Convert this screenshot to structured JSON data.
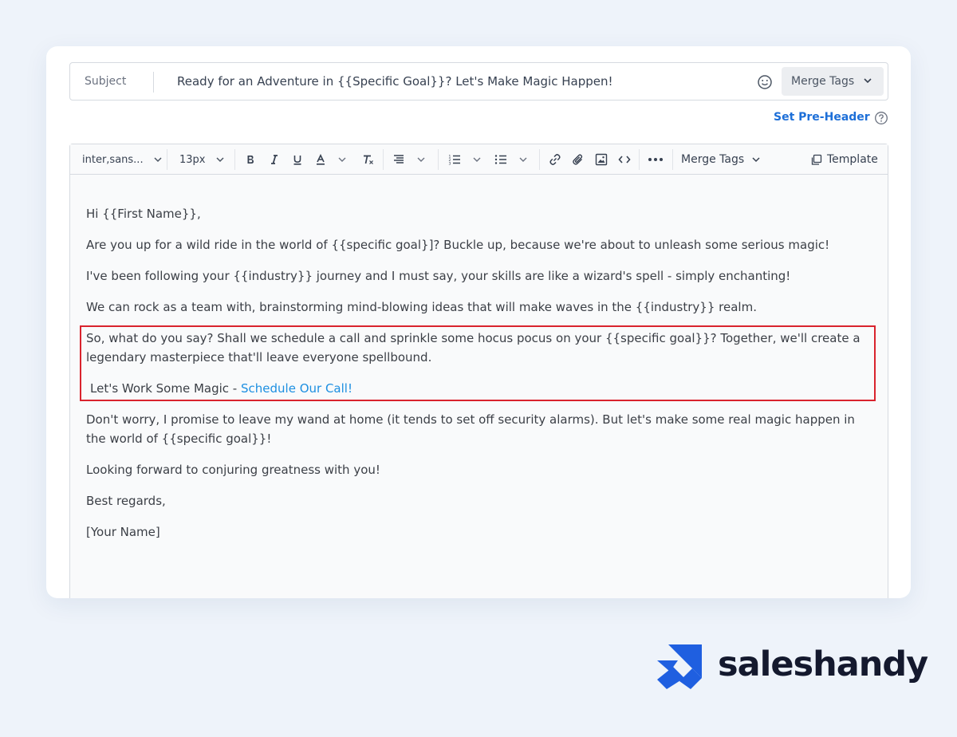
{
  "subject": {
    "label": "Subject",
    "value": "Ready for an Adventure in {{Specific Goal}}? Let's Make Magic Happen!",
    "merge_tags_label": "Merge Tags"
  },
  "preheader": {
    "link_label": "Set Pre-Header"
  },
  "toolbar": {
    "font_family": "inter,sans...",
    "font_size": "13px",
    "merge_tags_label": "Merge Tags",
    "template_label": "Template"
  },
  "email_body": {
    "greeting": "Hi {{First Name}},",
    "p1": "Are you up for a wild ride in the world of {{specific goal}]? Buckle up, because we're about to unleash some serious magic!",
    "p2": "I've been following your {{industry}} journey and I must say, your skills are like a wizard's spell - simply enchanting!",
    "p3": "We can rock as a team with, brainstorming mind-blowing ideas that will make waves in the {{industry}} realm.",
    "p4": "So, what do you say? Shall we schedule a call and sprinkle some hocus pocus on your {{specific goal}}? Together, we'll create a legendary masterpiece that'll leave everyone spellbound.",
    "cta_prefix": "Let's Work Some Magic - ",
    "cta_link": "Schedule Our Call!",
    "p5": "Don't worry, I promise to leave my wand at home (it tends to set off security alarms). But let's make some real magic happen in the world of {{specific goal}}!",
    "p6": "Looking forward to conjuring greatness with you!",
    "closing": "Best regards,",
    "signature": "[Your Name]"
  },
  "brand": {
    "name": "saleshandy",
    "logo_color": "#1f5fe0"
  },
  "colors": {
    "link": "#1d8fe1",
    "highlight_border": "#d9232d",
    "preheader_link": "#1d6fd8"
  }
}
